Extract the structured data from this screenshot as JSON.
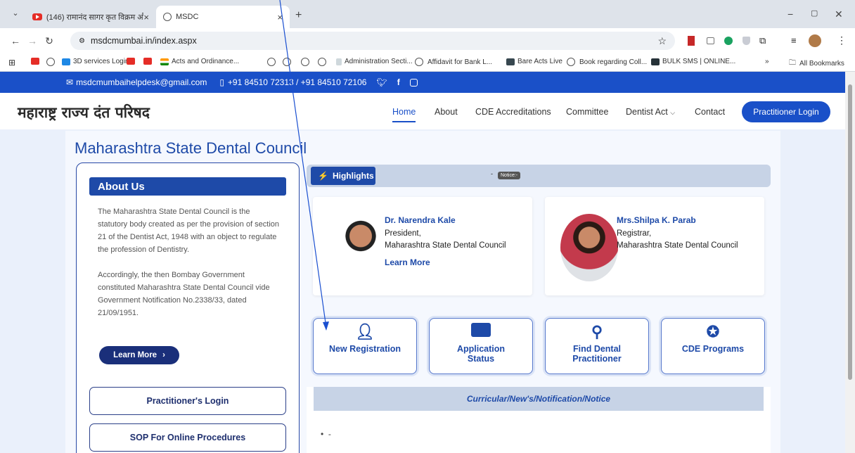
{
  "browser": {
    "tabs": [
      {
        "title": "(146) रामानंद सागर कृत विक्रम औ"
      },
      {
        "title": "MSDC"
      }
    ],
    "url": "msdcmumbai.in/index.aspx",
    "bookmarks": [
      "3D services Login",
      "Acts and Ordinance...",
      "Administration Secti...",
      "Affidavit for Bank L...",
      "Bare Acts Live",
      "Book regarding Coll...",
      "BULK SMS | ONLINE...",
      "»",
      "All Bookmarks"
    ]
  },
  "topbar": {
    "email": "msdcmumbaihelpdesk@gmail.com",
    "phone": "+91 84510 72313 / +91 84510 72106"
  },
  "header": {
    "brand": "महाराष्ट्र राज्य दंत परिषद",
    "nav": [
      "Home",
      "About",
      "CDE Accreditations",
      "Committee",
      "Dentist Act",
      "Contact"
    ],
    "login": "Practitioner Login"
  },
  "main": {
    "title": "Maharashtra State Dental Council",
    "about": {
      "heading": "About Us",
      "para1": "The Maharashtra State Dental Council is the statutory body created as per the provision of section 21 of the Dentist Act, 1948 with an object to regulate the profession of Dentistry.",
      "para2": "Accordingly, the then Bombay Government constituted Maharashtra State Dental Council vide Government Notification No.2338/33, dated 21/09/1951.",
      "learn_more": "Learn More",
      "btn1": "Practitioner's Login",
      "btn2": "SOP For Online Procedures"
    },
    "highlights": {
      "label": "Highlights",
      "notice": "Notice:-"
    },
    "president": {
      "name": "Dr. Narendra Kale",
      "role1": "President,",
      "role2": "Maharashtra State Dental Council",
      "more": "Learn More"
    },
    "registrar": {
      "name": "Mrs.Shilpa K. Parab",
      "role1": "Registrar,",
      "role2": "Maharashtra State Dental Council"
    },
    "tiles": [
      {
        "label": "New Registration",
        "icon": "user-icon"
      },
      {
        "label": "Application Status",
        "icon": "card-icon"
      },
      {
        "label": "Find Dental Practitioner",
        "icon": "search-icon"
      },
      {
        "label": "CDE Programs",
        "icon": "award-icon"
      }
    ],
    "news": {
      "heading": "Curricular/New's/Notification/Notice",
      "item": "-"
    }
  }
}
